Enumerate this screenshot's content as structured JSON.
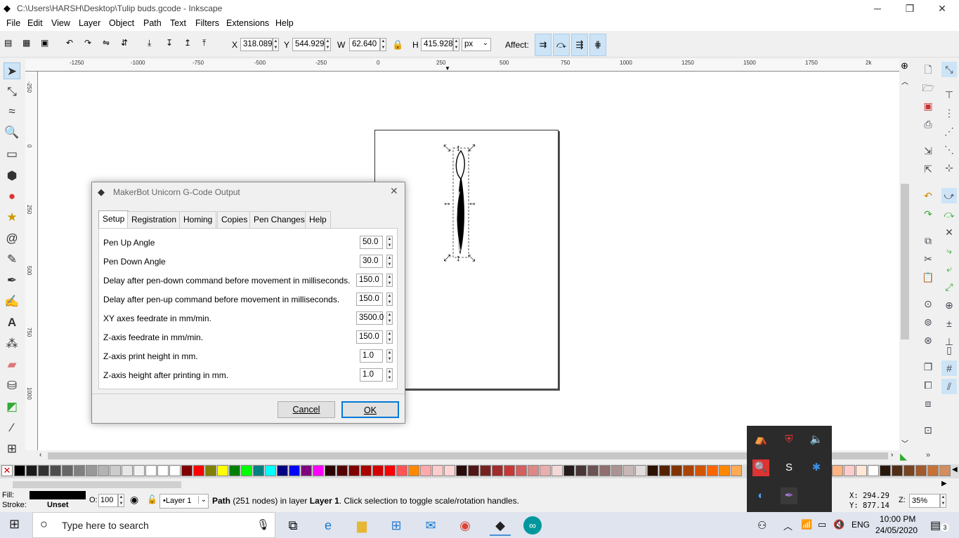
{
  "window": {
    "title": "C:\\Users\\HARSH\\Desktop\\Tulip buds.gcode - Inkscape",
    "minimize": "─",
    "maximize": "❐",
    "close": "✕"
  },
  "menu": [
    "File",
    "Edit",
    "View",
    "Layer",
    "Object",
    "Path",
    "Text",
    "Filters",
    "Extensions",
    "Help"
  ],
  "toolbar": {
    "x_label": "X",
    "x_value": "318.089",
    "y_label": "Y",
    "y_value": "544.929",
    "w_label": "W",
    "w_value": "62.640",
    "h_label": "H",
    "h_value": "415.928",
    "unit": "px",
    "affect_label": "Affect:"
  },
  "ruler": {
    "h_ticks": [
      "-1250",
      "-1000",
      "-750",
      "-500",
      "-250",
      "0",
      "250",
      "500",
      "750",
      "1000",
      "1250",
      "1500",
      "1750",
      "2k"
    ],
    "v_ticks": [
      "-250",
      "0",
      "250",
      "500",
      "750",
      "1000",
      "1250",
      "1500",
      "1750"
    ]
  },
  "dialog": {
    "title": "MakerBot Unicorn G-Code Output",
    "tabs": [
      "Setup",
      "Registration",
      "Homing",
      "Copies",
      "Pen Changes",
      "Help"
    ],
    "fields": [
      {
        "label": "Pen Up Angle",
        "value": "50.0"
      },
      {
        "label": "Pen Down Angle",
        "value": "30.0"
      },
      {
        "label": "Delay after pen-down command before movement in milliseconds.",
        "value": "150.0"
      },
      {
        "label": "Delay after pen-up command before movement in milliseconds.",
        "value": "150.0"
      },
      {
        "label": "XY axes feedrate in mm/min.",
        "value": "3500.0"
      },
      {
        "label": "Z-axis feedrate in mm/min.",
        "value": "150.0"
      },
      {
        "label": "Z-axis print height in mm.",
        "value": "1.0"
      },
      {
        "label": "Z-axis height after printing in mm.",
        "value": "1.0"
      }
    ],
    "cancel": "Cancel",
    "ok": "OK"
  },
  "status": {
    "fill_label": "Fill:",
    "stroke_label": "Stroke:",
    "stroke_value": "Unset",
    "opacity_label": "O:",
    "opacity_value": "100",
    "layer": "•Layer 1",
    "message_prefix": "Path",
    "message_nodes": " (251 nodes) in layer ",
    "message_layer": "Layer 1",
    "message_suffix": ". Click selection to toggle scale/rotation handles.",
    "x_coord": "X:  294.29",
    "y_coord": "Y:  877.14",
    "zoom_label": "Z:",
    "zoom_value": "35%"
  },
  "taskbar": {
    "search_placeholder": "Type here to search",
    "language": "ENG",
    "time": "10:00 PM",
    "date": "24/05/2020",
    "notifications": "3"
  },
  "colors": {
    "accent": "#cde4f7",
    "taskbar": "#dfe4ee"
  }
}
